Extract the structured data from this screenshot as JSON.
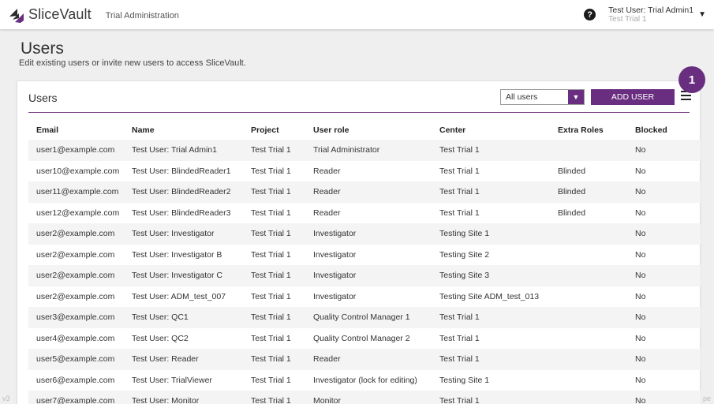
{
  "app": {
    "name": "SliceVault",
    "section": "Trial Administration"
  },
  "user_menu": {
    "name": "Test User: Trial Admin1",
    "trial": "Test Trial 1"
  },
  "page": {
    "title": "Users",
    "subtitle": "Edit existing users or invite new users to access SliceVault."
  },
  "card": {
    "title": "Users",
    "filter": {
      "value": "All users"
    },
    "add_button": "ADD USER",
    "badge": "1"
  },
  "corners": {
    "left": "v3",
    "right": "pe"
  },
  "colors": {
    "accent": "#6a2e80",
    "logo_dark": "#2b2b2b",
    "logo_purple": "#6a2e80"
  },
  "icons": {
    "help": "question-circle-icon",
    "menu": "hamburger-menu-icon",
    "caret": "caret-down-icon",
    "select_arrow": "triangle-down-icon"
  },
  "table": {
    "columns": [
      "Email",
      "Name",
      "Project",
      "User role",
      "Center",
      "Extra Roles",
      "Blocked"
    ],
    "rows": [
      [
        "user1@example.com",
        "Test User: Trial Admin1",
        "Test Trial 1",
        "Trial Administrator",
        "Test Trial 1",
        "",
        "No"
      ],
      [
        "user10@example.com",
        "Test User: BlindedReader1",
        "Test Trial 1",
        "Reader",
        "Test Trial 1",
        "Blinded",
        "No"
      ],
      [
        "user11@example.com",
        "Test User: BlindedReader2",
        "Test Trial 1",
        "Reader",
        "Test Trial 1",
        "Blinded",
        "No"
      ],
      [
        "user12@example.com",
        "Test User: BlindedReader3",
        "Test Trial 1",
        "Reader",
        "Test Trial 1",
        "Blinded",
        "No"
      ],
      [
        "user2@example.com",
        "Test User: Investigator",
        "Test Trial 1",
        "Investigator",
        "Testing Site 1",
        "",
        "No"
      ],
      [
        "user2@example.com",
        "Test User: Investigator B",
        "Test Trial 1",
        "Investigator",
        "Testing Site 2",
        "",
        "No"
      ],
      [
        "user2@example.com",
        "Test User: Investigator C",
        "Test Trial 1",
        "Investigator",
        "Testing Site 3",
        "",
        "No"
      ],
      [
        "user2@example.com",
        "Test User: ADM_test_007",
        "Test Trial 1",
        "Investigator",
        "Testing Site ADM_test_013",
        "",
        "No"
      ],
      [
        "user3@example.com",
        "Test User: QC1",
        "Test Trial 1",
        "Quality Control Manager 1",
        "Test Trial 1",
        "",
        "No"
      ],
      [
        "user4@example.com",
        "Test User: QC2",
        "Test Trial 1",
        "Quality Control Manager 2",
        "Test Trial 1",
        "",
        "No"
      ],
      [
        "user5@example.com",
        "Test User: Reader",
        "Test Trial 1",
        "Reader",
        "Test Trial 1",
        "",
        "No"
      ],
      [
        "user6@example.com",
        "Test User: TrialViewer",
        "Test Trial 1",
        "Investigator (lock for editing)",
        "Testing Site 1",
        "",
        "No"
      ],
      [
        "user7@example.com",
        "Test User: Monitor",
        "Test Trial 1",
        "Monitor",
        "Test Trial 1",
        "",
        "No"
      ]
    ]
  }
}
